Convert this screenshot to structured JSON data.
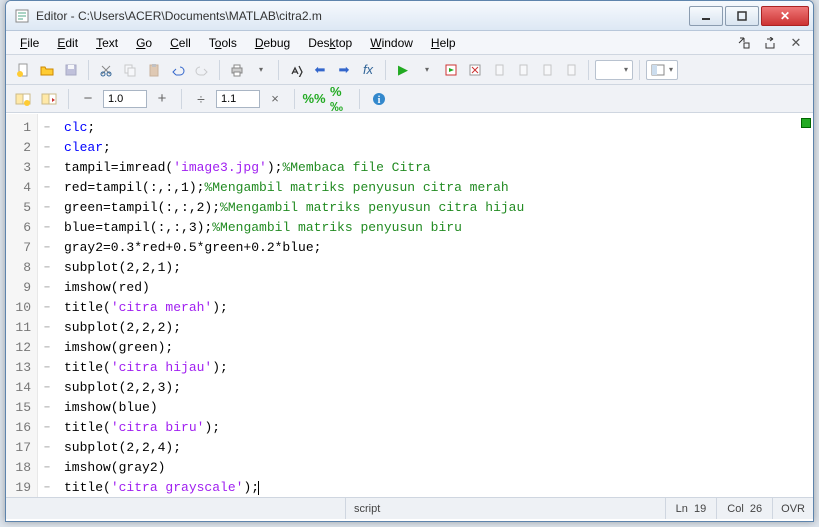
{
  "window": {
    "title": "Editor - C:\\Users\\ACER\\Documents\\MATLAB\\citra2.m"
  },
  "menu": {
    "file": "File",
    "edit": "Edit",
    "text": "Text",
    "go": "Go",
    "cell": "Cell",
    "tools": "Tools",
    "debug": "Debug",
    "desktop": "Desktop",
    "window": "Window",
    "help": "Help"
  },
  "celltoolbar": {
    "box1": "1.0",
    "box2": "1.1"
  },
  "code": {
    "lines_count": 19,
    "l1": {
      "kw": "clc",
      "rest": ";"
    },
    "l2": {
      "kw": "clear",
      "rest": ";"
    },
    "l3": {
      "p1": "tampil=imread(",
      "s": "'image3.jpg'",
      "p2": ");",
      "c": "%Membaca file Citra"
    },
    "l4": {
      "p1": "red=tampil(:,:,1);",
      "c": "%Mengambil matriks penyusun citra merah"
    },
    "l5": {
      "p1": "green=tampil(:,:,2);",
      "c": "%Mengambil matriks penyusun citra hijau"
    },
    "l6": {
      "p1": "blue=tampil(:,:,3);",
      "c": "%Mengambil matriks penyusun biru"
    },
    "l7": {
      "p1": "gray2=0.3*red+0.5*green+0.2*blue;"
    },
    "l8": {
      "p1": "subplot(2,2,1);"
    },
    "l9": {
      "p1": "imshow(red)"
    },
    "l10": {
      "p1": "title(",
      "s": "'citra merah'",
      "p2": ");"
    },
    "l11": {
      "p1": "subplot(2,2,2);"
    },
    "l12": {
      "p1": "imshow(green);"
    },
    "l13": {
      "p1": "title(",
      "s": "'citra hijau'",
      "p2": ");"
    },
    "l14": {
      "p1": "subplot(2,2,3);"
    },
    "l15": {
      "p1": "imshow(blue)"
    },
    "l16": {
      "p1": "title(",
      "s": "'citra biru'",
      "p2": ");"
    },
    "l17": {
      "p1": "subplot(2,2,4);"
    },
    "l18": {
      "p1": "imshow(gray2)"
    },
    "l19": {
      "p1": "title(",
      "s": "'citra grayscale'",
      "p2": ");"
    }
  },
  "status": {
    "type": "script",
    "ln_label": "Ln",
    "ln": "19",
    "col_label": "Col",
    "col": "26",
    "ovr": "OVR"
  },
  "gutter": [
    "1",
    "2",
    "3",
    "4",
    "5",
    "6",
    "7",
    "8",
    "9",
    "10",
    "11",
    "12",
    "13",
    "14",
    "15",
    "16",
    "17",
    "18",
    "19"
  ]
}
